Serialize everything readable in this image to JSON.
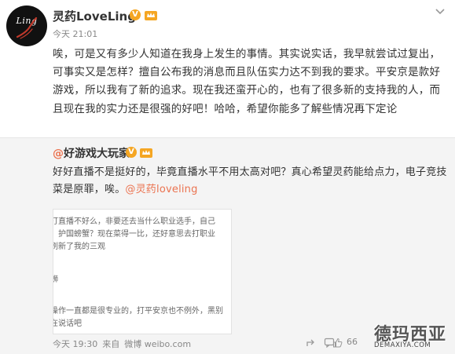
{
  "post": {
    "avatar_logo_text": "Ling",
    "username": "灵药LoveLing",
    "verified_badge": "V",
    "member_icon": "crown-icon",
    "time": "今天 21:01",
    "content": "唉，可是又有多少人知道在我身上发生的事情。其实说实话，我早就尝试过复出，可事实又是怎样？擅自公布我的消息而且队伍实力达不到我的要求。平安京是款好游戏，所以我有了新的追求。现在我还蛮开心的，也有了很多新的支持我的人，而且现在我的实力还是很强的好吧！哈哈，希望你能多了解些情况再下定论"
  },
  "repost": {
    "at": "@",
    "username": "好游戏大玩家",
    "verified_badge": "V",
    "text": "好好直播不是挺好的，毕竟直播水平不用太高对吧？真心希望灵药能给点力，电子竞技菜是原罪，唉。",
    "mention": "@灵药loveling",
    "thumb_lines": [
      "打直播不好么，非要还去当什么职业选手，自己",
      "，护国螃蟹？现在菜得一比，还好意思去打职业",
      "刷新了我的三观",
      "蛳",
      "操作一直都是很专业的，打平安京也不例外，黑别",
      "在说话吧"
    ],
    "footer": {
      "time": "今天 19:30",
      "source_prefix": "来自",
      "source": "微博 weibo.com",
      "like_count": "66"
    }
  },
  "watermark": {
    "cn": "德玛西亚",
    "en": "DEMAXIYA.COM"
  },
  "colors": {
    "mention": "#eb7350",
    "badge": "#f5a623",
    "repost_bg": "#f4f4f4"
  }
}
